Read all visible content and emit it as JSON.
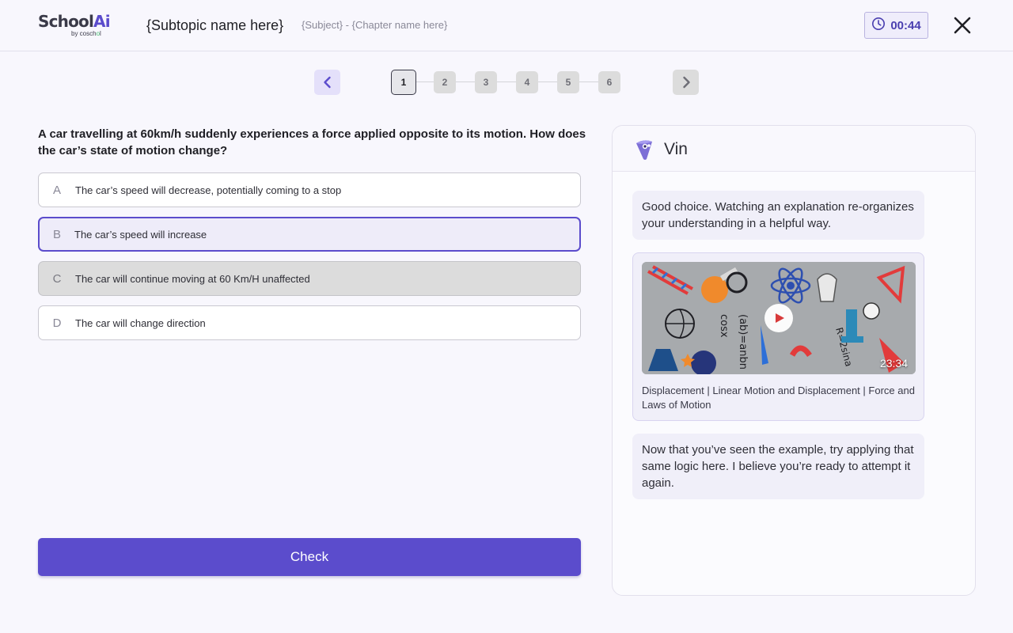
{
  "header": {
    "logo_main": "School",
    "logo_ai": "Ai",
    "logo_sub_prefix": "by cosch",
    "logo_sub_dot": "o",
    "logo_sub_suffix": "l",
    "subtopic": "{Subtopic name here}",
    "breadcrumb": "{Subject} - {Chapter name here}",
    "timer": "00:44",
    "timer_icon": "clock-icon",
    "close_icon": "close-icon"
  },
  "pager": {
    "steps": [
      "1",
      "2",
      "3",
      "4",
      "5",
      "6"
    ],
    "active_step": "1",
    "prev_icon": "chevron-left-icon",
    "next_icon": "chevron-right-icon"
  },
  "question": {
    "text": "A car travelling at 60km/h suddenly experiences a force applied opposite to its motion. How does the car’s state of motion change?",
    "options": [
      {
        "letter": "A",
        "text": "The car’s speed will decrease, potentially coming to a stop",
        "state": "default"
      },
      {
        "letter": "B",
        "text": "The car’s speed will increase",
        "state": "selected"
      },
      {
        "letter": "C",
        "text": "The car will continue moving at 60 Km/H unaffected",
        "state": "disabled"
      },
      {
        "letter": "D",
        "text": "The car will change direction",
        "state": "default"
      }
    ],
    "check_label": "Check"
  },
  "chat": {
    "bot_name": "Vin",
    "messages": [
      {
        "text": "Good choice. Watching an explanation re-organizes your understanding in a helpful way."
      },
      {
        "text": "Now that you’ve seen the example, try applying that same logic here. I believe you’re ready to attempt it again."
      }
    ],
    "video": {
      "duration": "23:34",
      "title": "Displacement | Linear Motion and Displacement | Force and Laws of Motion",
      "play_icon": "play-icon"
    }
  },
  "colors": {
    "accent": "#5b4ccc",
    "accent_light": "#eeecf9",
    "background": "#f8f7fd"
  }
}
